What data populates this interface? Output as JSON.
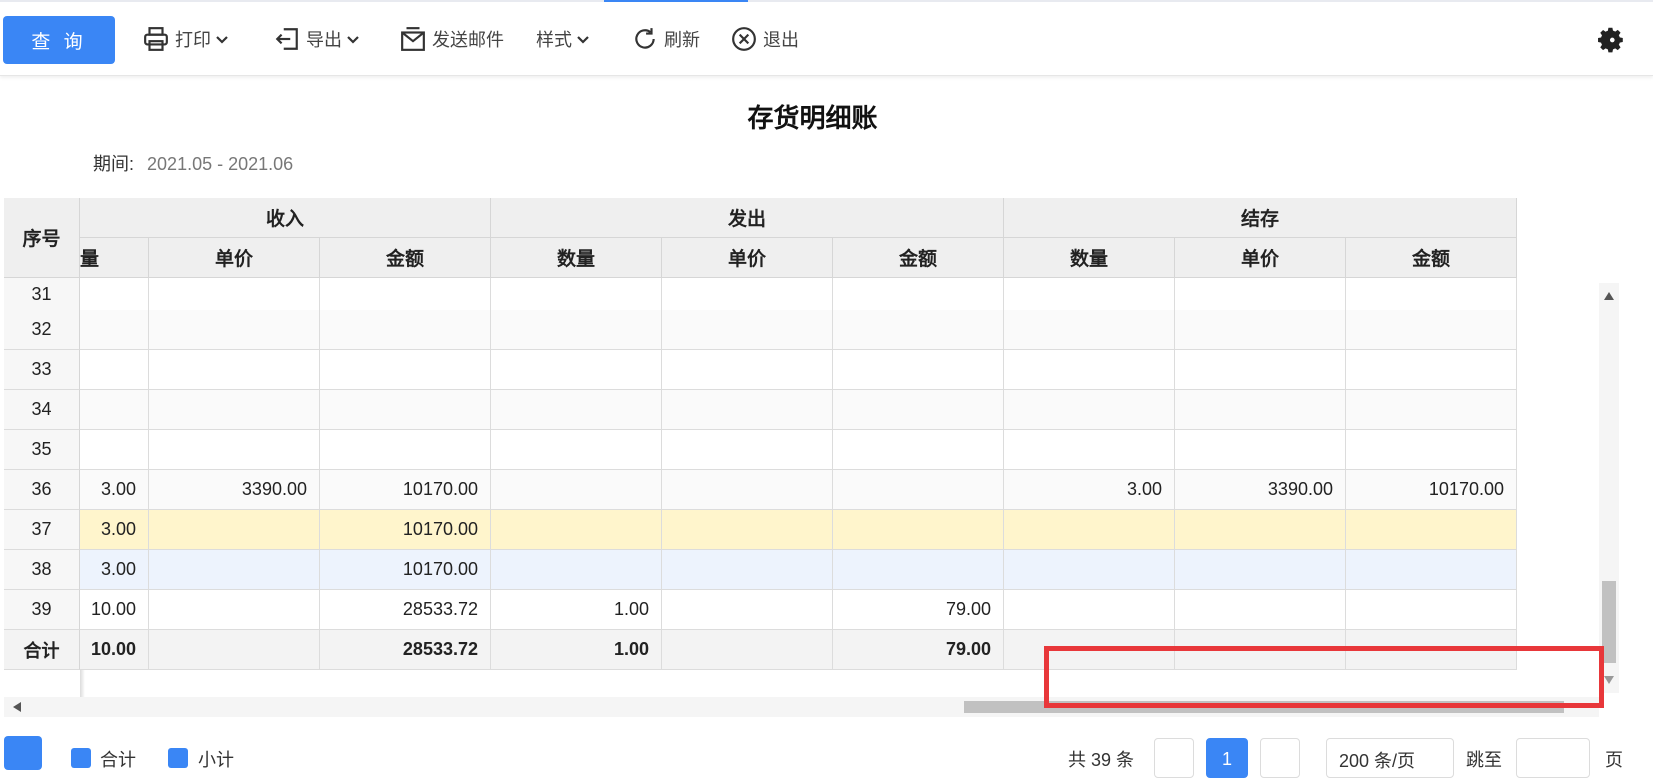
{
  "toolbar": {
    "query_label": "查 询",
    "print_label": "打印",
    "export_label": "导出",
    "email_label": "发送邮件",
    "style_label": "样式",
    "refresh_label": "刷新",
    "exit_label": "退出"
  },
  "report": {
    "title": "存货明细账",
    "period_label": "期间:",
    "period_value": "2021.05 - 2021.06"
  },
  "table": {
    "seq_header": "序号",
    "group_headers": [
      "收入",
      "发出",
      "结存"
    ],
    "partial_header": "量",
    "sub_headers": [
      "单价",
      "金额",
      "数量",
      "单价",
      "金额",
      "数量",
      "单价",
      "金额"
    ],
    "rows": [
      {
        "seq": "31",
        "cells": [
          "",
          "",
          "",
          "",
          "",
          "",
          "",
          "",
          ""
        ]
      },
      {
        "seq": "32",
        "cells": [
          "",
          "",
          "",
          "",
          "",
          "",
          "",
          "",
          ""
        ]
      },
      {
        "seq": "33",
        "cells": [
          "",
          "",
          "",
          "",
          "",
          "",
          "",
          "",
          ""
        ]
      },
      {
        "seq": "34",
        "cells": [
          "",
          "",
          "",
          "",
          "",
          "",
          "",
          "",
          ""
        ]
      },
      {
        "seq": "35",
        "cells": [
          "",
          "",
          "",
          "",
          "",
          "",
          "",
          "",
          ""
        ]
      },
      {
        "seq": "36",
        "cells": [
          "3.00",
          "3390.00",
          "10170.00",
          "",
          "",
          "",
          "3.00",
          "3390.00",
          "10170.00"
        ]
      },
      {
        "seq": "37",
        "cells": [
          "3.00",
          "",
          "10170.00",
          "",
          "",
          "",
          "",
          "",
          ""
        ],
        "style": "yellow"
      },
      {
        "seq": "38",
        "cells": [
          "3.00",
          "",
          "10170.00",
          "",
          "",
          "",
          "",
          "",
          ""
        ],
        "style": "blue"
      },
      {
        "seq": "39",
        "cells": [
          "10.00",
          "",
          "28533.72",
          "1.00",
          "",
          "79.00",
          "",
          "",
          ""
        ]
      }
    ],
    "total": {
      "seq": "合计",
      "cells": [
        "10.00",
        "",
        "28533.72",
        "1.00",
        "",
        "79.00",
        "",
        "",
        ""
      ]
    }
  },
  "footer": {
    "total_chk_label": "合计",
    "subtotal_chk_label": "小计",
    "count_text": "共 39 条",
    "current_page": "1",
    "page_size": "200 条/页",
    "jump_label": "跳至",
    "page_unit": "页"
  },
  "colors": {
    "accent": "#3a86f5",
    "highlight_yellow": "#fff5cc",
    "highlight_blue": "#edf3fd",
    "red_box": "#e8373a"
  }
}
